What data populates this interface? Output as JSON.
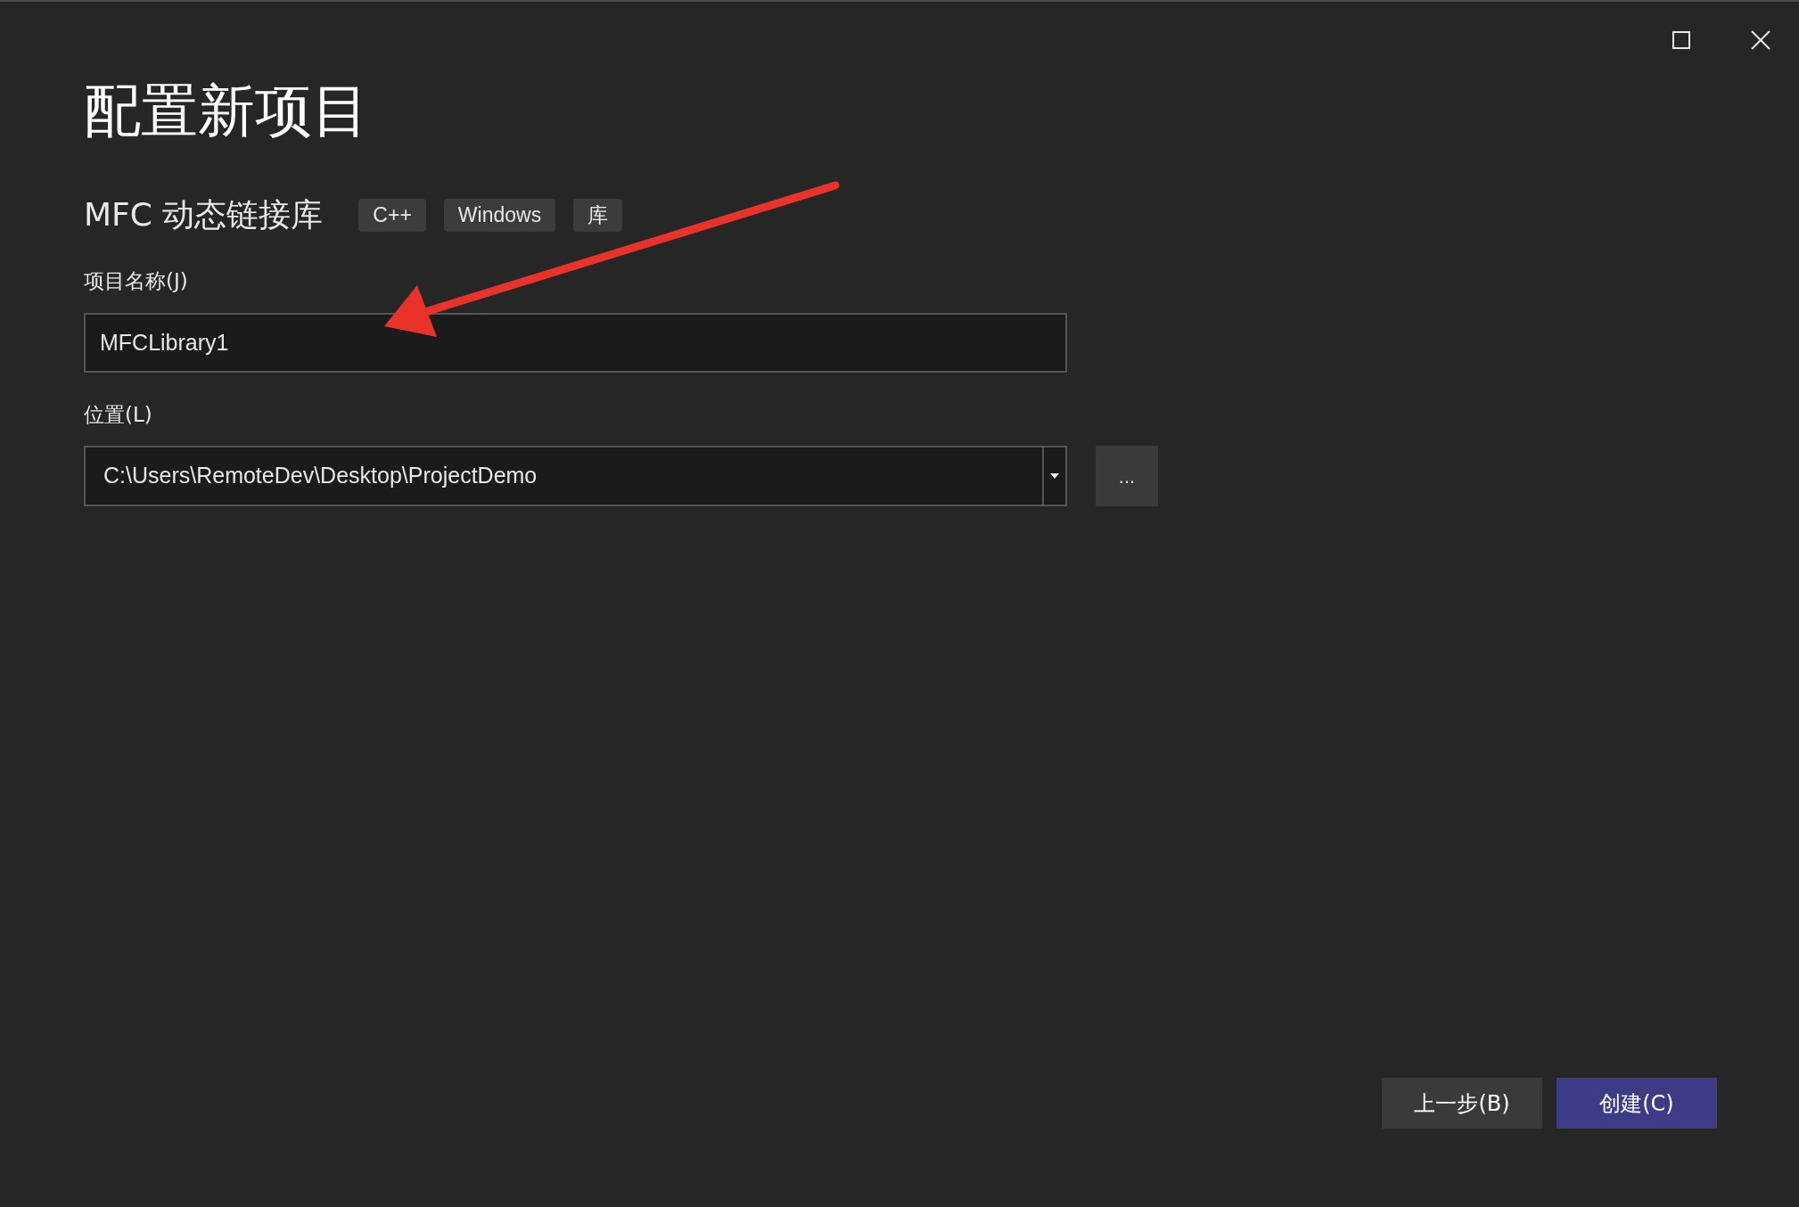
{
  "dialog": {
    "title": "配置新项目",
    "template_name": "MFC 动态链接库",
    "tags": [
      "C++",
      "Windows",
      "库"
    ],
    "fields": [
      {
        "kind": "text",
        "label": "项目名称(J)",
        "value": "MFCLibrary1"
      },
      {
        "kind": "dropdown",
        "label": "位置(L)",
        "value": "C:\\Users\\RemoteDev\\Desktop\\ProjectDemo",
        "browse_label": "..."
      }
    ],
    "buttons": [
      {
        "label": "上一步(B)",
        "primary": false
      },
      {
        "label": "创建(C)",
        "primary": true
      }
    ]
  }
}
